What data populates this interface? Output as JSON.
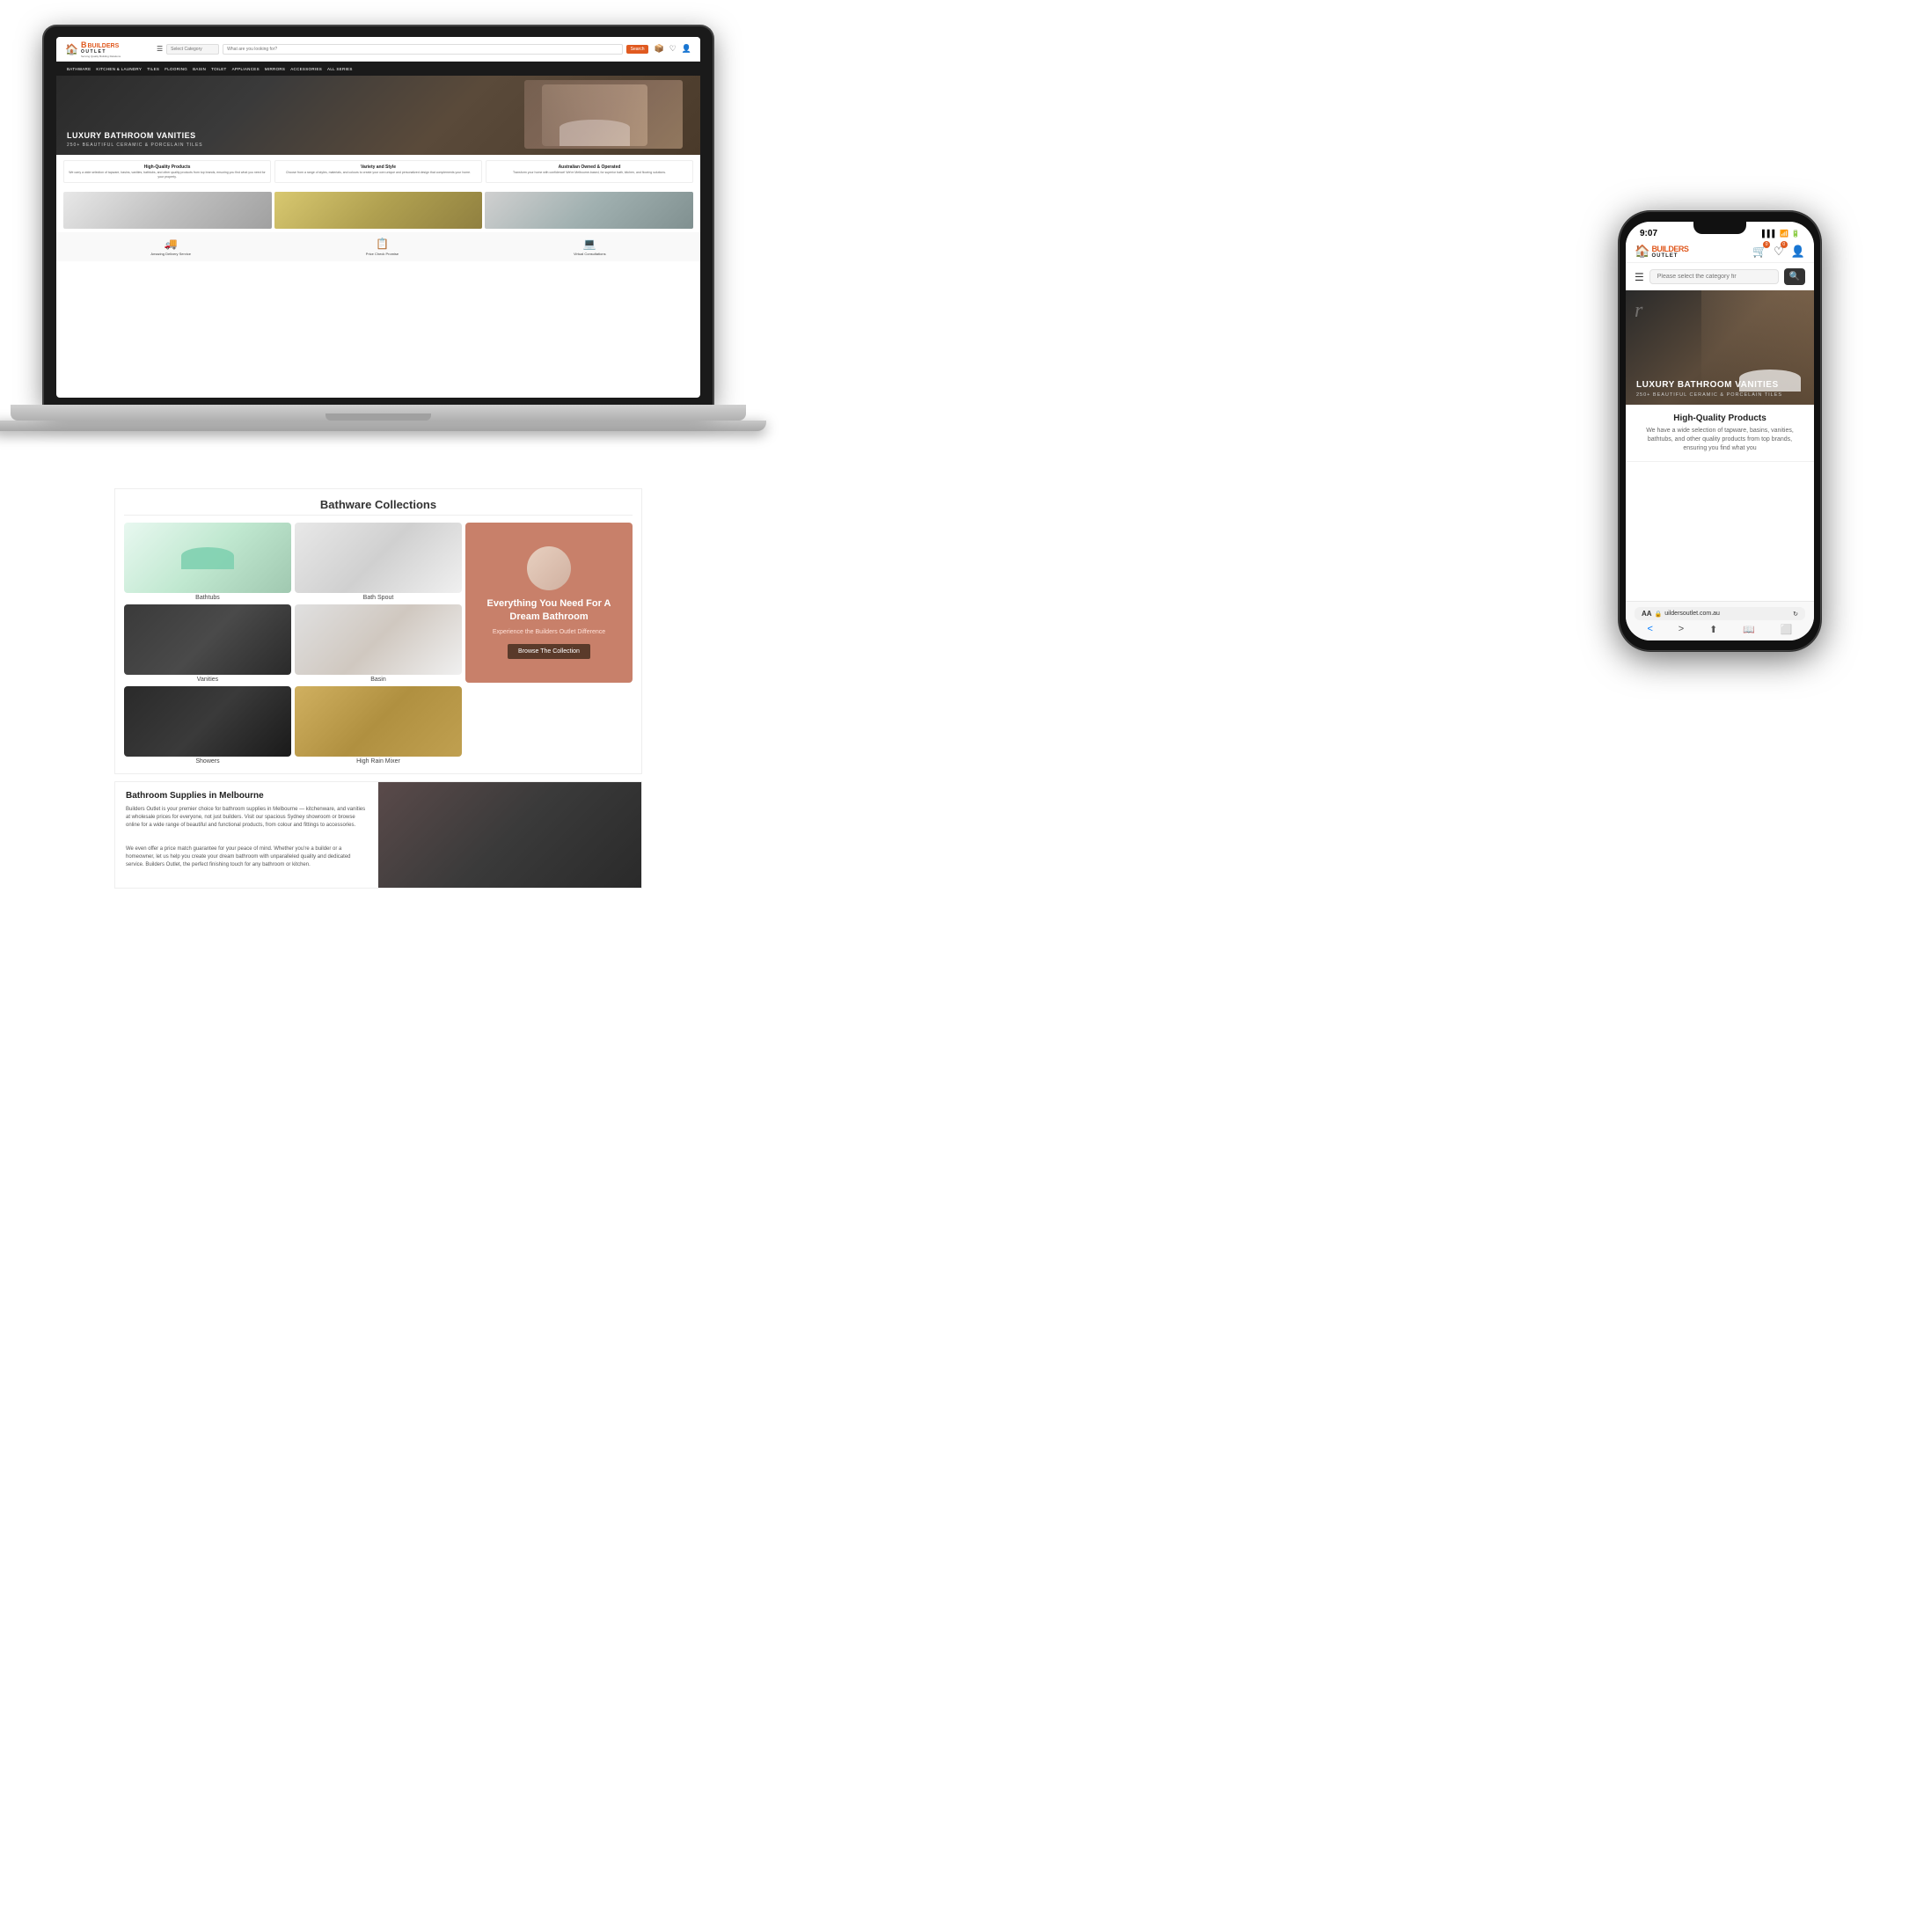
{
  "brand": {
    "name": "Builders Outlet",
    "builders": "BUILDERS",
    "outlet": "OUTLET",
    "tagline": "Serving Quality Building Relations",
    "logo_icon": "🏠"
  },
  "laptop": {
    "header": {
      "hamburger": "☰",
      "category_placeholder": "Select Category",
      "search_placeholder": "What are you looking for?",
      "search_btn": "Search",
      "icons": [
        "📦",
        "♡",
        "👤"
      ]
    },
    "nav": {
      "items": [
        "BATHWARE",
        "KITCHEN & LAUNDRY",
        "TILES",
        "FLOORING",
        "BASIN",
        "TOILET",
        "APPLIANCES",
        "MIRRORS",
        "ACCESSORIES",
        "ALL SERIES"
      ]
    },
    "hero": {
      "title": "LUXURY BATHROOM VANITIES",
      "subtitle": "250+ BEAUTIFUL CERAMIC & PORCELAIN TILES"
    },
    "features": [
      {
        "title": "High-Quality Products",
        "desc": "We carry a wide selection of tapware, basins, vanities, bathtubs, and other quality products from top brands, ensuring you find what you need for your property."
      },
      {
        "title": "Variety and Style",
        "desc": "Choose from a range of styles, materials, and colours to create your own unique and personalized design that complements your home."
      },
      {
        "title": "Australian Owned & Operated",
        "desc": "Transform your home with confidence! We're Melbourne-based, for superior bath, kitchen, and flooring solutions."
      }
    ],
    "services": [
      {
        "icon": "🚚",
        "label": "Amazing Delivery Service"
      },
      {
        "icon": "📋",
        "label": "Price Check Promise"
      },
      {
        "icon": "💻",
        "label": "Virtual Consultations"
      }
    ]
  },
  "phone": {
    "status_bar": {
      "time": "9:07",
      "signal": "▌▌▌",
      "wifi": "WiFi",
      "battery": "🔋"
    },
    "header": {
      "cart_count": "0",
      "wishlist_count": "0"
    },
    "search": {
      "hamburger": "☰",
      "placeholder": "Please select the category fir",
      "search_icon": "🔍"
    },
    "hero": {
      "title": "LUXURY BATHROOM VANITIES",
      "subtitle": "250+ BEAUTIFUL CERAMIC & PORCELAIN TILES"
    },
    "feature": {
      "title": "High-Quality Products",
      "desc": "We have a wide selection of tapware, basins, vanities, bathtubs, and other quality products from top brands, ensuring you find what you"
    },
    "url_bar": {
      "aa_label": "AA",
      "lock_icon": "🔒",
      "url": "uildersoutlet.com.au",
      "refresh_icon": "↻"
    },
    "nav_buttons": {
      "back": "<",
      "forward": ">",
      "share": "⬆",
      "bookmark": "📖",
      "tabs": "⬜"
    }
  },
  "bathware": {
    "section_title": "Bathware Collections",
    "items": [
      {
        "label": "Bathtubs"
      },
      {
        "label": "Bath Spout"
      },
      {
        "label": ""
      },
      {
        "label": "Vanities"
      },
      {
        "label": "Basin"
      },
      {
        "label": ""
      },
      {
        "label": "Showers"
      },
      {
        "label": "High Rain Mixer"
      }
    ],
    "cta": {
      "title": "Everything You Need For A Dream Bathroom",
      "subtitle": "Experience the Builders Outlet Difference",
      "button_label": "Browse The Collection"
    }
  },
  "supplies": {
    "title": "Bathroom Supplies in Melbourne",
    "desc1": "Builders Outlet is your premier choice for bathroom supplies in Melbourne — kitchenware, and vanities at wholesale prices for everyone, not just builders. Visit our spacious Sydney showroom or browse online for a wide range of beautiful and functional products, from colour and fittings to accessories.",
    "desc2": "We even offer a price match guarantee for your peace of mind. Whether you're a builder or a homeowner, let us help you create your dream bathroom with unparalleled quality and dedicated service. Builders Outlet, the perfect finishing touch for any bathroom or kitchen."
  }
}
